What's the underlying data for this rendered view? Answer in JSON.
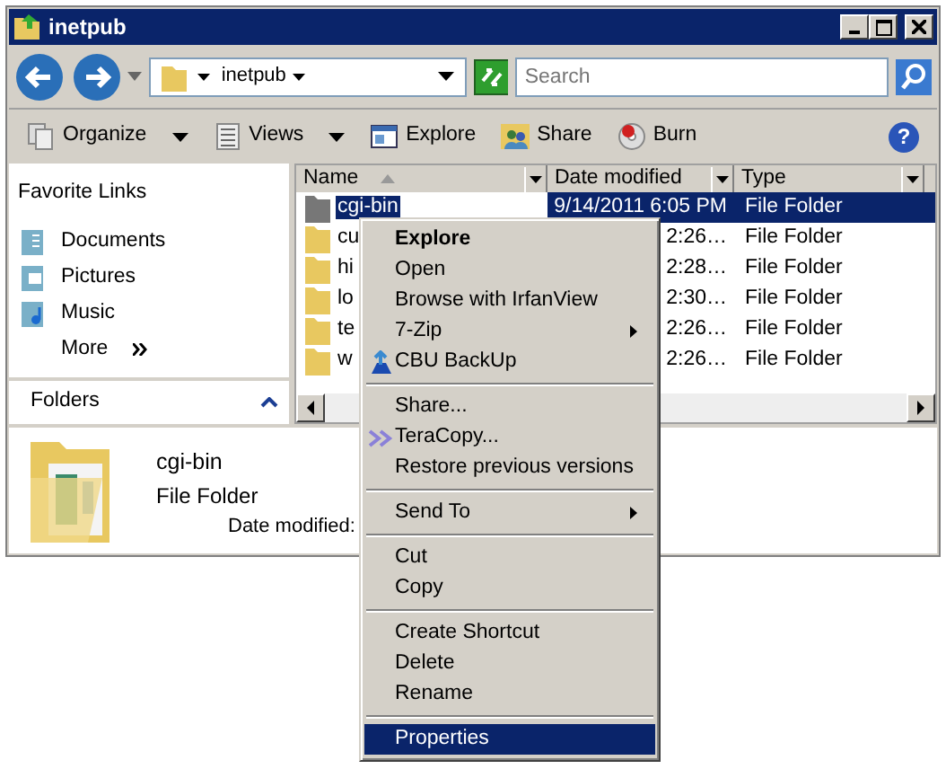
{
  "window": {
    "title": "inetpub"
  },
  "address": {
    "crumbs": [
      "inetpub"
    ]
  },
  "search": {
    "placeholder": "Search"
  },
  "help": "?",
  "toolbar": [
    {
      "label": "Organize",
      "dropdown": true
    },
    {
      "label": "Views",
      "dropdown": true
    },
    {
      "label": "Explore",
      "dropdown": false
    },
    {
      "label": "Share",
      "dropdown": false
    },
    {
      "label": "Burn",
      "dropdown": false
    }
  ],
  "favorite_links": {
    "title": "Favorite Links",
    "items": [
      {
        "label": "Documents"
      },
      {
        "label": "Pictures"
      },
      {
        "label": "Music"
      }
    ],
    "more": "More"
  },
  "folders": {
    "label": "Folders"
  },
  "columns": [
    {
      "label": "Name",
      "sorted": true
    },
    {
      "label": "Date modified",
      "sorted": false
    },
    {
      "label": "Type",
      "sorted": false
    }
  ],
  "rows": [
    {
      "name": "cgi-bin",
      "date": "9/14/2011 6:05 PM",
      "type": "File Folder",
      "selected": true
    },
    {
      "name": "cu",
      "date": "2:26…",
      "type": "File Folder",
      "selected": false
    },
    {
      "name": "hi",
      "date": "2:28…",
      "type": "File Folder",
      "selected": false
    },
    {
      "name": "lo",
      "date": "2:30…",
      "type": "File Folder",
      "selected": false
    },
    {
      "name": "te",
      "date": "2:26…",
      "type": "File Folder",
      "selected": false
    },
    {
      "name": "w",
      "date": "2:26…",
      "type": "File Folder",
      "selected": false
    }
  ],
  "details": {
    "name": "cgi-bin",
    "type": "File Folder",
    "date_label": "Date modified:"
  },
  "context_menu": [
    {
      "kind": "item",
      "label": "Explore",
      "bold": true,
      "submenu": false,
      "selected": false
    },
    {
      "kind": "item",
      "label": "Open",
      "bold": false,
      "submenu": false,
      "selected": false
    },
    {
      "kind": "item",
      "label": "Browse with IrfanView",
      "bold": false,
      "submenu": false,
      "selected": false
    },
    {
      "kind": "item",
      "label": "7-Zip",
      "bold": false,
      "submenu": true,
      "selected": false
    },
    {
      "kind": "item",
      "label": "CBU BackUp",
      "bold": false,
      "submenu": false,
      "selected": false
    },
    {
      "kind": "separator"
    },
    {
      "kind": "item",
      "label": "Share...",
      "bold": false,
      "submenu": false,
      "selected": false
    },
    {
      "kind": "item",
      "label": "TeraCopy...",
      "bold": false,
      "submenu": false,
      "selected": false
    },
    {
      "kind": "item",
      "label": "Restore previous versions",
      "bold": false,
      "submenu": false,
      "selected": false
    },
    {
      "kind": "separator"
    },
    {
      "kind": "item",
      "label": "Send To",
      "bold": false,
      "submenu": true,
      "selected": false
    },
    {
      "kind": "separator"
    },
    {
      "kind": "item",
      "label": "Cut",
      "bold": false,
      "submenu": false,
      "selected": false
    },
    {
      "kind": "item",
      "label": "Copy",
      "bold": false,
      "submenu": false,
      "selected": false
    },
    {
      "kind": "separator"
    },
    {
      "kind": "item",
      "label": "Create Shortcut",
      "bold": false,
      "submenu": false,
      "selected": false
    },
    {
      "kind": "item",
      "label": "Delete",
      "bold": false,
      "submenu": false,
      "selected": false
    },
    {
      "kind": "item",
      "label": "Rename",
      "bold": false,
      "submenu": false,
      "selected": false
    },
    {
      "kind": "separator"
    },
    {
      "kind": "item",
      "label": "Properties",
      "bold": false,
      "submenu": false,
      "selected": true
    }
  ]
}
